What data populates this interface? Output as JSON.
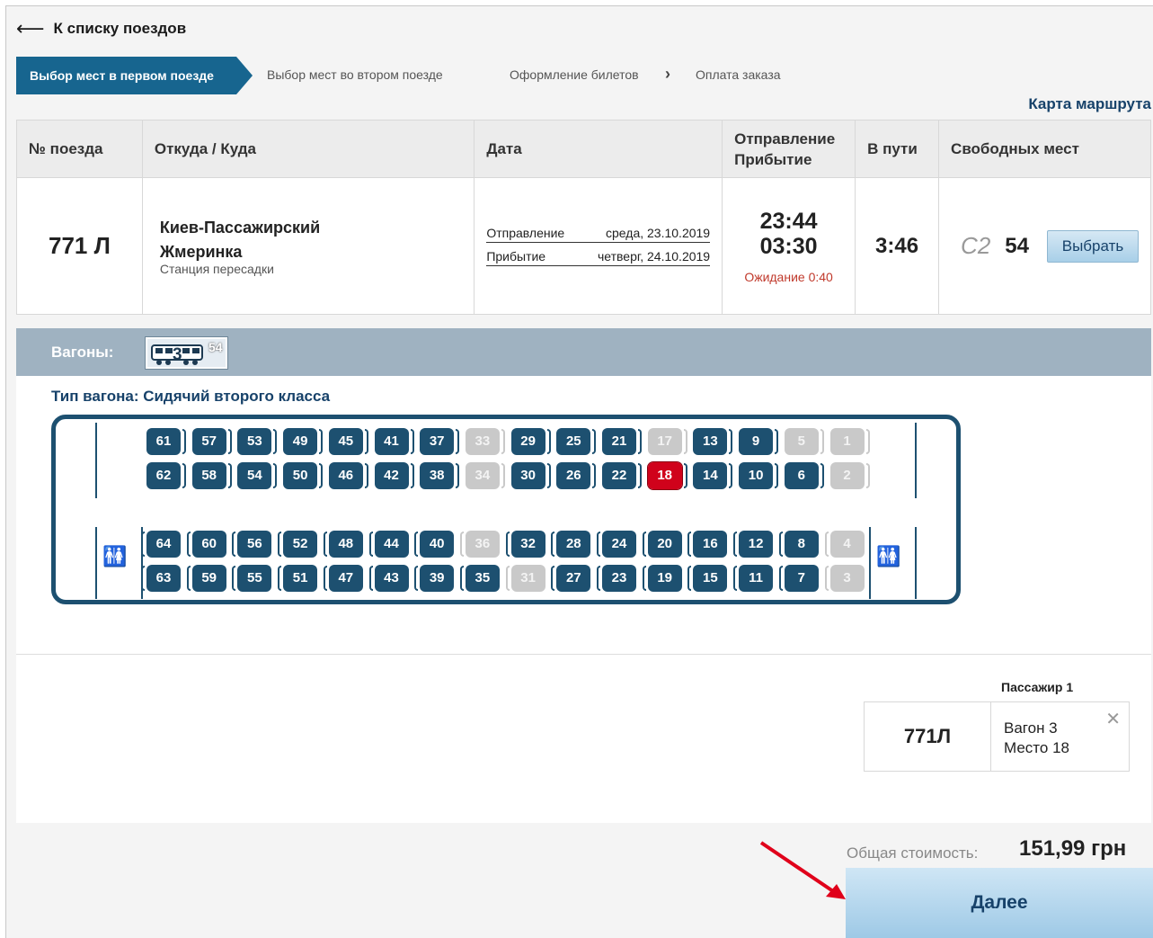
{
  "nav": {
    "back_label": "К списку поездов"
  },
  "steps": {
    "active": "Выбор мест в первом поезде",
    "second": "Выбор мест во втором поезде",
    "third": "Оформление билетов",
    "fourth": "Оплата заказа"
  },
  "route_map_label": "Карта маршрута",
  "table": {
    "headers": {
      "train_no": "№ поезда",
      "from_to": "Откуда / Куда",
      "date": "Дата",
      "dep_arr_1": "Отправление",
      "dep_arr_2": "Прибытие",
      "travel": "В пути",
      "free": "Свободных мест"
    },
    "row": {
      "train_no": "771 Л",
      "from": "Киев-Пассажирский",
      "to": "Жмеринка",
      "transfer": "Станция пересадки",
      "dep_label": "Отправление",
      "dep_date": "среда, 23.10.2019",
      "arr_label": "Прибытие",
      "arr_date": "четверг, 24.10.2019",
      "dep_time": "23:44",
      "arr_time": "03:30",
      "waiting": "Ожидание 0:40",
      "travel_time": "3:46",
      "class_code": "С2",
      "free_count": "54",
      "choose_label": "Выбрать"
    }
  },
  "wagons": {
    "label": "Вагоны:",
    "tab_number": "3",
    "tab_count": "54",
    "type_label": "Тип вагона: Сидячий второго класса"
  },
  "seats": {
    "selected": "18",
    "row1": [
      "61",
      "57",
      "53",
      "49",
      "45",
      "41",
      "37",
      "33",
      "29",
      "25",
      "21",
      "17",
      "13",
      "9",
      "5",
      "1"
    ],
    "row2": [
      "62",
      "58",
      "54",
      "50",
      "46",
      "42",
      "38",
      "34",
      "30",
      "26",
      "22",
      "18",
      "14",
      "10",
      "6",
      "2"
    ],
    "row3": [
      "64",
      "60",
      "56",
      "52",
      "48",
      "44",
      "40",
      "36",
      "32",
      "28",
      "24",
      "20",
      "16",
      "12",
      "8",
      "4"
    ],
    "row4": [
      "63",
      "59",
      "55",
      "51",
      "47",
      "43",
      "39",
      "35",
      "31",
      "27",
      "23",
      "19",
      "15",
      "11",
      "7",
      "3"
    ],
    "busy": [
      "33",
      "34",
      "36",
      "31",
      "17",
      "5",
      "1",
      "2",
      "4",
      "3"
    ]
  },
  "summary": {
    "passenger_label": "Пассажир 1",
    "train": "771Л",
    "wagon": "Вагон 3",
    "seat": "Место 18",
    "total_label": "Общая стоимость:",
    "total_value": "151,99 грн",
    "next_label": "Далее"
  },
  "colors": {
    "primary": "#17658f",
    "seat": "#1d5070",
    "selected": "#d0021b",
    "busy": "#c9c9c9",
    "annotation_arrow": "#e0001a"
  }
}
